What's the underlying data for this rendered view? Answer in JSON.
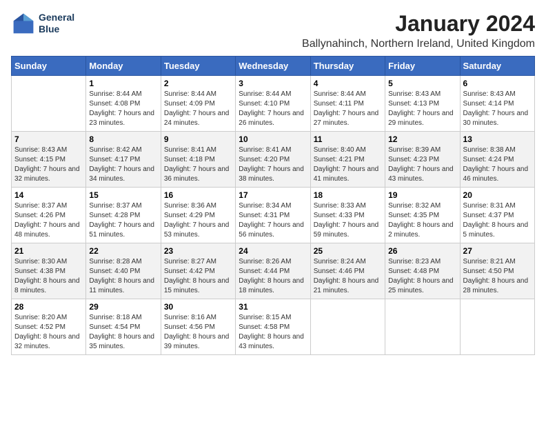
{
  "logo": {
    "line1": "General",
    "line2": "Blue"
  },
  "title": "January 2024",
  "subtitle": "Ballynahinch, Northern Ireland, United Kingdom",
  "weekdays": [
    "Sunday",
    "Monday",
    "Tuesday",
    "Wednesday",
    "Thursday",
    "Friday",
    "Saturday"
  ],
  "weeks": [
    [
      {
        "day": "",
        "sunrise": "",
        "sunset": "",
        "daylight": ""
      },
      {
        "day": "1",
        "sunrise": "Sunrise: 8:44 AM",
        "sunset": "Sunset: 4:08 PM",
        "daylight": "Daylight: 7 hours and 23 minutes."
      },
      {
        "day": "2",
        "sunrise": "Sunrise: 8:44 AM",
        "sunset": "Sunset: 4:09 PM",
        "daylight": "Daylight: 7 hours and 24 minutes."
      },
      {
        "day": "3",
        "sunrise": "Sunrise: 8:44 AM",
        "sunset": "Sunset: 4:10 PM",
        "daylight": "Daylight: 7 hours and 26 minutes."
      },
      {
        "day": "4",
        "sunrise": "Sunrise: 8:44 AM",
        "sunset": "Sunset: 4:11 PM",
        "daylight": "Daylight: 7 hours and 27 minutes."
      },
      {
        "day": "5",
        "sunrise": "Sunrise: 8:43 AM",
        "sunset": "Sunset: 4:13 PM",
        "daylight": "Daylight: 7 hours and 29 minutes."
      },
      {
        "day": "6",
        "sunrise": "Sunrise: 8:43 AM",
        "sunset": "Sunset: 4:14 PM",
        "daylight": "Daylight: 7 hours and 30 minutes."
      }
    ],
    [
      {
        "day": "7",
        "sunrise": "Sunrise: 8:43 AM",
        "sunset": "Sunset: 4:15 PM",
        "daylight": "Daylight: 7 hours and 32 minutes."
      },
      {
        "day": "8",
        "sunrise": "Sunrise: 8:42 AM",
        "sunset": "Sunset: 4:17 PM",
        "daylight": "Daylight: 7 hours and 34 minutes."
      },
      {
        "day": "9",
        "sunrise": "Sunrise: 8:41 AM",
        "sunset": "Sunset: 4:18 PM",
        "daylight": "Daylight: 7 hours and 36 minutes."
      },
      {
        "day": "10",
        "sunrise": "Sunrise: 8:41 AM",
        "sunset": "Sunset: 4:20 PM",
        "daylight": "Daylight: 7 hours and 38 minutes."
      },
      {
        "day": "11",
        "sunrise": "Sunrise: 8:40 AM",
        "sunset": "Sunset: 4:21 PM",
        "daylight": "Daylight: 7 hours and 41 minutes."
      },
      {
        "day": "12",
        "sunrise": "Sunrise: 8:39 AM",
        "sunset": "Sunset: 4:23 PM",
        "daylight": "Daylight: 7 hours and 43 minutes."
      },
      {
        "day": "13",
        "sunrise": "Sunrise: 8:38 AM",
        "sunset": "Sunset: 4:24 PM",
        "daylight": "Daylight: 7 hours and 46 minutes."
      }
    ],
    [
      {
        "day": "14",
        "sunrise": "Sunrise: 8:37 AM",
        "sunset": "Sunset: 4:26 PM",
        "daylight": "Daylight: 7 hours and 48 minutes."
      },
      {
        "day": "15",
        "sunrise": "Sunrise: 8:37 AM",
        "sunset": "Sunset: 4:28 PM",
        "daylight": "Daylight: 7 hours and 51 minutes."
      },
      {
        "day": "16",
        "sunrise": "Sunrise: 8:36 AM",
        "sunset": "Sunset: 4:29 PM",
        "daylight": "Daylight: 7 hours and 53 minutes."
      },
      {
        "day": "17",
        "sunrise": "Sunrise: 8:34 AM",
        "sunset": "Sunset: 4:31 PM",
        "daylight": "Daylight: 7 hours and 56 minutes."
      },
      {
        "day": "18",
        "sunrise": "Sunrise: 8:33 AM",
        "sunset": "Sunset: 4:33 PM",
        "daylight": "Daylight: 7 hours and 59 minutes."
      },
      {
        "day": "19",
        "sunrise": "Sunrise: 8:32 AM",
        "sunset": "Sunset: 4:35 PM",
        "daylight": "Daylight: 8 hours and 2 minutes."
      },
      {
        "day": "20",
        "sunrise": "Sunrise: 8:31 AM",
        "sunset": "Sunset: 4:37 PM",
        "daylight": "Daylight: 8 hours and 5 minutes."
      }
    ],
    [
      {
        "day": "21",
        "sunrise": "Sunrise: 8:30 AM",
        "sunset": "Sunset: 4:38 PM",
        "daylight": "Daylight: 8 hours and 8 minutes."
      },
      {
        "day": "22",
        "sunrise": "Sunrise: 8:28 AM",
        "sunset": "Sunset: 4:40 PM",
        "daylight": "Daylight: 8 hours and 11 minutes."
      },
      {
        "day": "23",
        "sunrise": "Sunrise: 8:27 AM",
        "sunset": "Sunset: 4:42 PM",
        "daylight": "Daylight: 8 hours and 15 minutes."
      },
      {
        "day": "24",
        "sunrise": "Sunrise: 8:26 AM",
        "sunset": "Sunset: 4:44 PM",
        "daylight": "Daylight: 8 hours and 18 minutes."
      },
      {
        "day": "25",
        "sunrise": "Sunrise: 8:24 AM",
        "sunset": "Sunset: 4:46 PM",
        "daylight": "Daylight: 8 hours and 21 minutes."
      },
      {
        "day": "26",
        "sunrise": "Sunrise: 8:23 AM",
        "sunset": "Sunset: 4:48 PM",
        "daylight": "Daylight: 8 hours and 25 minutes."
      },
      {
        "day": "27",
        "sunrise": "Sunrise: 8:21 AM",
        "sunset": "Sunset: 4:50 PM",
        "daylight": "Daylight: 8 hours and 28 minutes."
      }
    ],
    [
      {
        "day": "28",
        "sunrise": "Sunrise: 8:20 AM",
        "sunset": "Sunset: 4:52 PM",
        "daylight": "Daylight: 8 hours and 32 minutes."
      },
      {
        "day": "29",
        "sunrise": "Sunrise: 8:18 AM",
        "sunset": "Sunset: 4:54 PM",
        "daylight": "Daylight: 8 hours and 35 minutes."
      },
      {
        "day": "30",
        "sunrise": "Sunrise: 8:16 AM",
        "sunset": "Sunset: 4:56 PM",
        "daylight": "Daylight: 8 hours and 39 minutes."
      },
      {
        "day": "31",
        "sunrise": "Sunrise: 8:15 AM",
        "sunset": "Sunset: 4:58 PM",
        "daylight": "Daylight: 8 hours and 43 minutes."
      },
      {
        "day": "",
        "sunrise": "",
        "sunset": "",
        "daylight": ""
      },
      {
        "day": "",
        "sunrise": "",
        "sunset": "",
        "daylight": ""
      },
      {
        "day": "",
        "sunrise": "",
        "sunset": "",
        "daylight": ""
      }
    ]
  ]
}
